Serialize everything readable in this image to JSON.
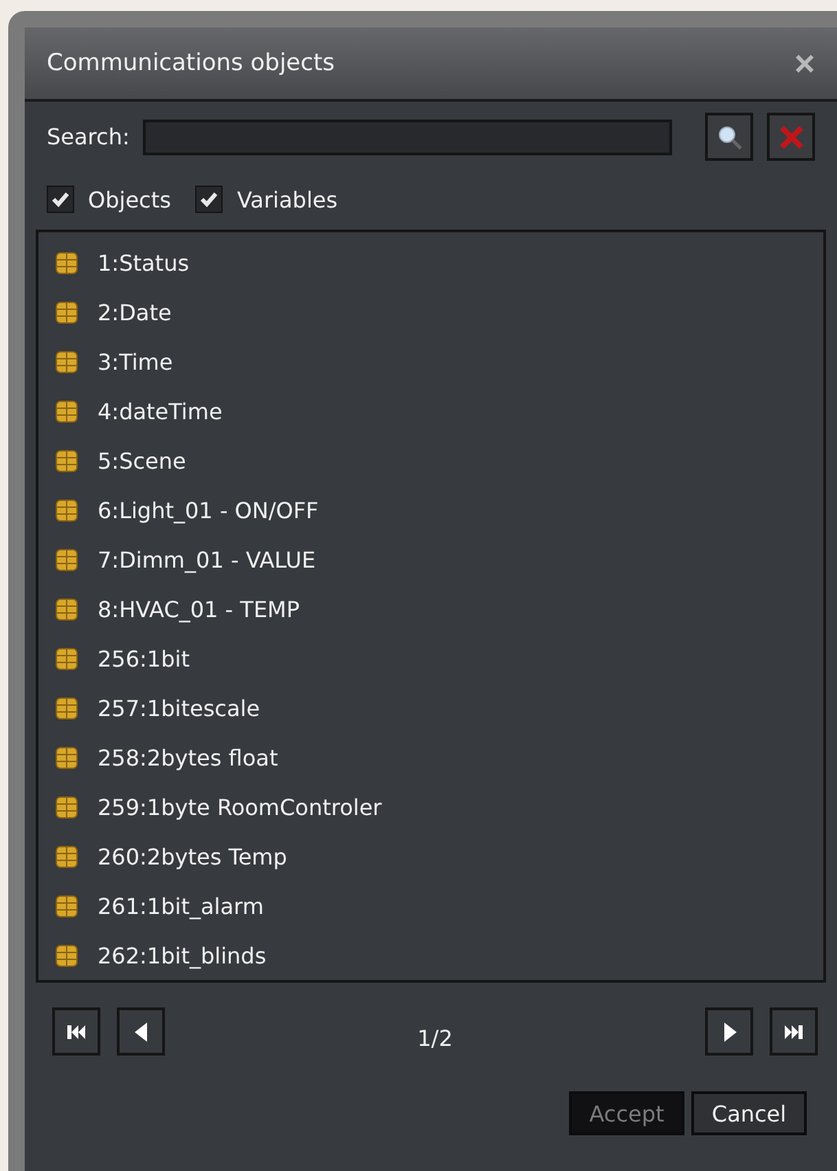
{
  "dialog": {
    "title": "Communications objects",
    "close": "×"
  },
  "search": {
    "label": "Search:"
  },
  "filters": [
    {
      "label": "Objects",
      "checked": true
    },
    {
      "label": "Variables",
      "checked": true
    }
  ],
  "items": [
    "1:Status",
    "2:Date",
    "3:Time",
    "4:dateTime",
    "5:Scene",
    "6:Light_01 - ON/OFF",
    "7:Dimm_01 - VALUE",
    "8:HVAC_01 - TEMP",
    "256:1bit",
    "257:1bitescale",
    "258:2bytes float",
    "259:1byte RoomControler",
    "260:2bytes Temp",
    "261:1bit_alarm",
    "262:1bit_blinds"
  ],
  "pager": {
    "page": "1/2"
  },
  "buttons": [
    {
      "label": "Accept",
      "disabled": true
    },
    {
      "label": "Cancel",
      "disabled": false
    }
  ]
}
